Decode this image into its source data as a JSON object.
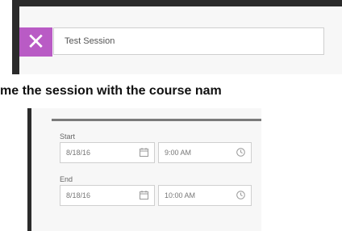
{
  "top": {
    "session_name_value": "Test Session",
    "close_icon_glyph": "✕"
  },
  "caption": "me the session with the course nam",
  "schedule": {
    "start_label": "Start",
    "start_date": "8/18/16",
    "start_time": "9:00 AM",
    "end_label": "End",
    "end_date": "8/18/16",
    "end_time": "10:00 AM"
  },
  "colors": {
    "accent": "#b95bc5",
    "panel_bg": "#f7f7f7",
    "edge": "#2b2b2b"
  }
}
